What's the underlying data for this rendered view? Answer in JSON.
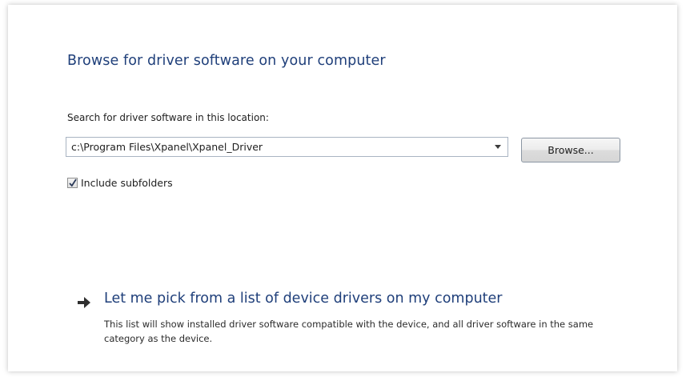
{
  "page": {
    "heading": "Browse for driver software on your computer"
  },
  "search": {
    "label": "Search for driver software in this location:",
    "path_value": "c:\\Program Files\\Xpanel\\Xpanel_Driver",
    "dropdown_icon": "chevron-down-icon",
    "browse_label": "Browse..."
  },
  "subfolders": {
    "checked": true,
    "label": "Include subfolders"
  },
  "pick_option": {
    "icon": "arrow-right-icon",
    "title": "Let me pick from a list of device drivers on my computer",
    "description": "This list will show installed driver software compatible with the device, and all driver software in the same category as the device."
  },
  "colors": {
    "heading": "#1f3f7a",
    "text": "#1e1e1e",
    "background": "#ffffff"
  }
}
